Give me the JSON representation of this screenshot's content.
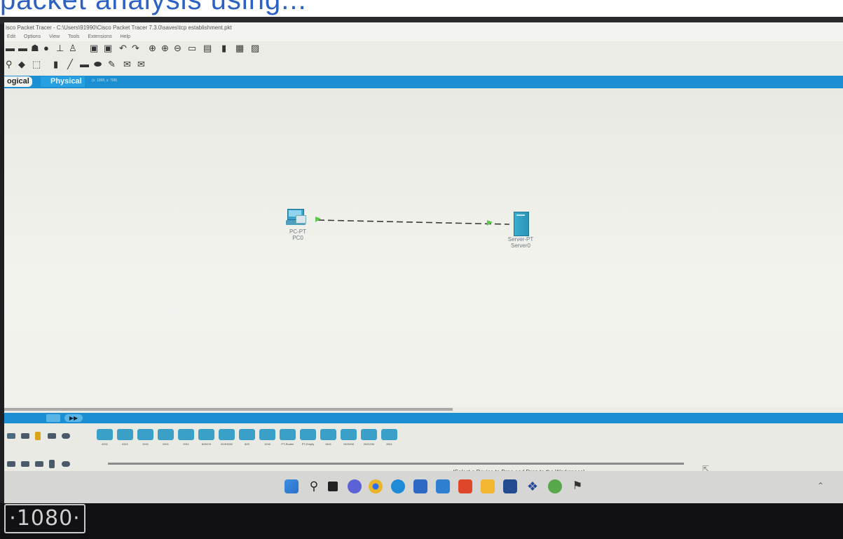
{
  "caption": {
    "text": "packet analysis using..."
  },
  "window": {
    "title": "isco Packet Tracer - C:\\Users\\91990\\Cisco Packet Tracer 7.3.0\\saves\\tcp establishment.pkt",
    "menu": [
      "Edit",
      "Options",
      "View",
      "Tools",
      "Extensions",
      "Help"
    ]
  },
  "tabs": {
    "logical": "ogical",
    "physical": "Physical",
    "coords": "(x: 1368, y: 708)"
  },
  "topology": {
    "pc": {
      "type": "PC-PT",
      "name": "PC0"
    },
    "server": {
      "type": "Server-PT",
      "name": "Server0"
    }
  },
  "device_list": [
    "4331",
    "4321",
    "1941",
    "2901",
    "2911",
    "819IOX",
    "819HGW",
    "829",
    "1240",
    "PT-Router",
    "PT-Empty",
    "1841",
    "2620XM",
    "2621XM",
    "2811"
  ],
  "status": {
    "hint": "(Select a Device to Drag and Drop to the Workspace)"
  },
  "monitor": {
    "badge": "·1080·"
  },
  "colors": {
    "accent": "#1b8fd1",
    "link": "#3b3b3b",
    "link_light": "#5cc84a"
  }
}
